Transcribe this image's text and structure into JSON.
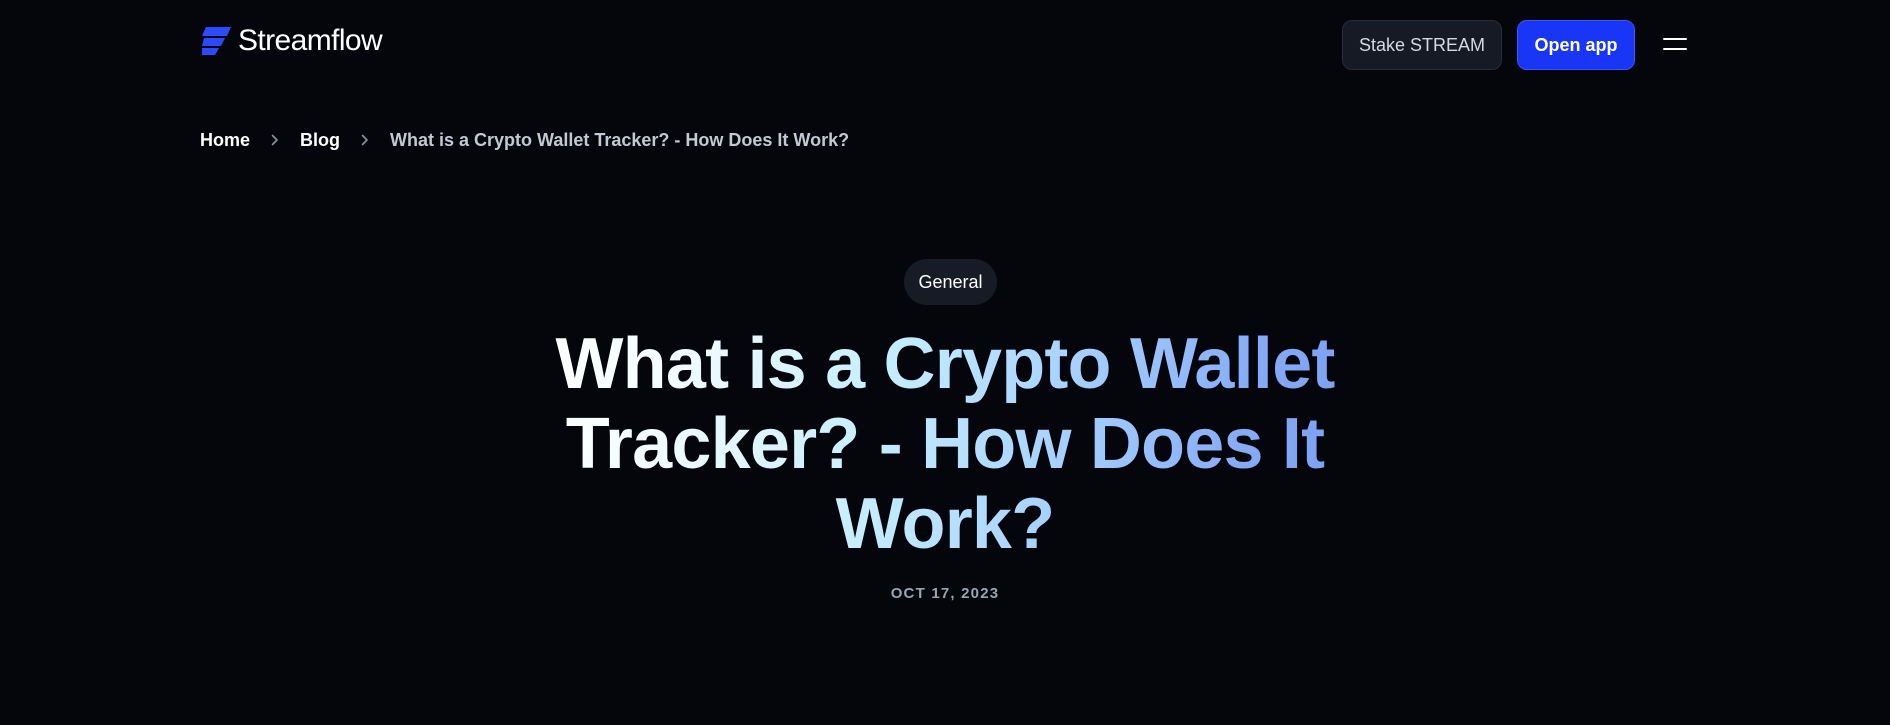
{
  "header": {
    "brand": "Streamflow",
    "logo_icon": "streamflow-logo-icon",
    "stake_label": "Stake STREAM",
    "open_app_label": "Open app",
    "menu_icon": "hamburger-menu-icon"
  },
  "breadcrumb": {
    "items": [
      {
        "label": "Home"
      },
      {
        "label": "Blog"
      },
      {
        "label": "What is a Crypto Wallet Tracker? - How Does It Work?"
      }
    ],
    "separator_icon": "chevron-right-icon"
  },
  "article": {
    "category": "General",
    "title": "What is a Crypto Wallet Tracker? - How Does It Work?",
    "date": "OCT 17, 2023"
  },
  "colors": {
    "background": "#04060b",
    "primary_button": "#1935f5",
    "secondary_button": "#151a25",
    "logo_accent": "#2a4bff",
    "title_gradient_start": "#ffffff",
    "title_gradient_end": "#7b9ef2"
  }
}
